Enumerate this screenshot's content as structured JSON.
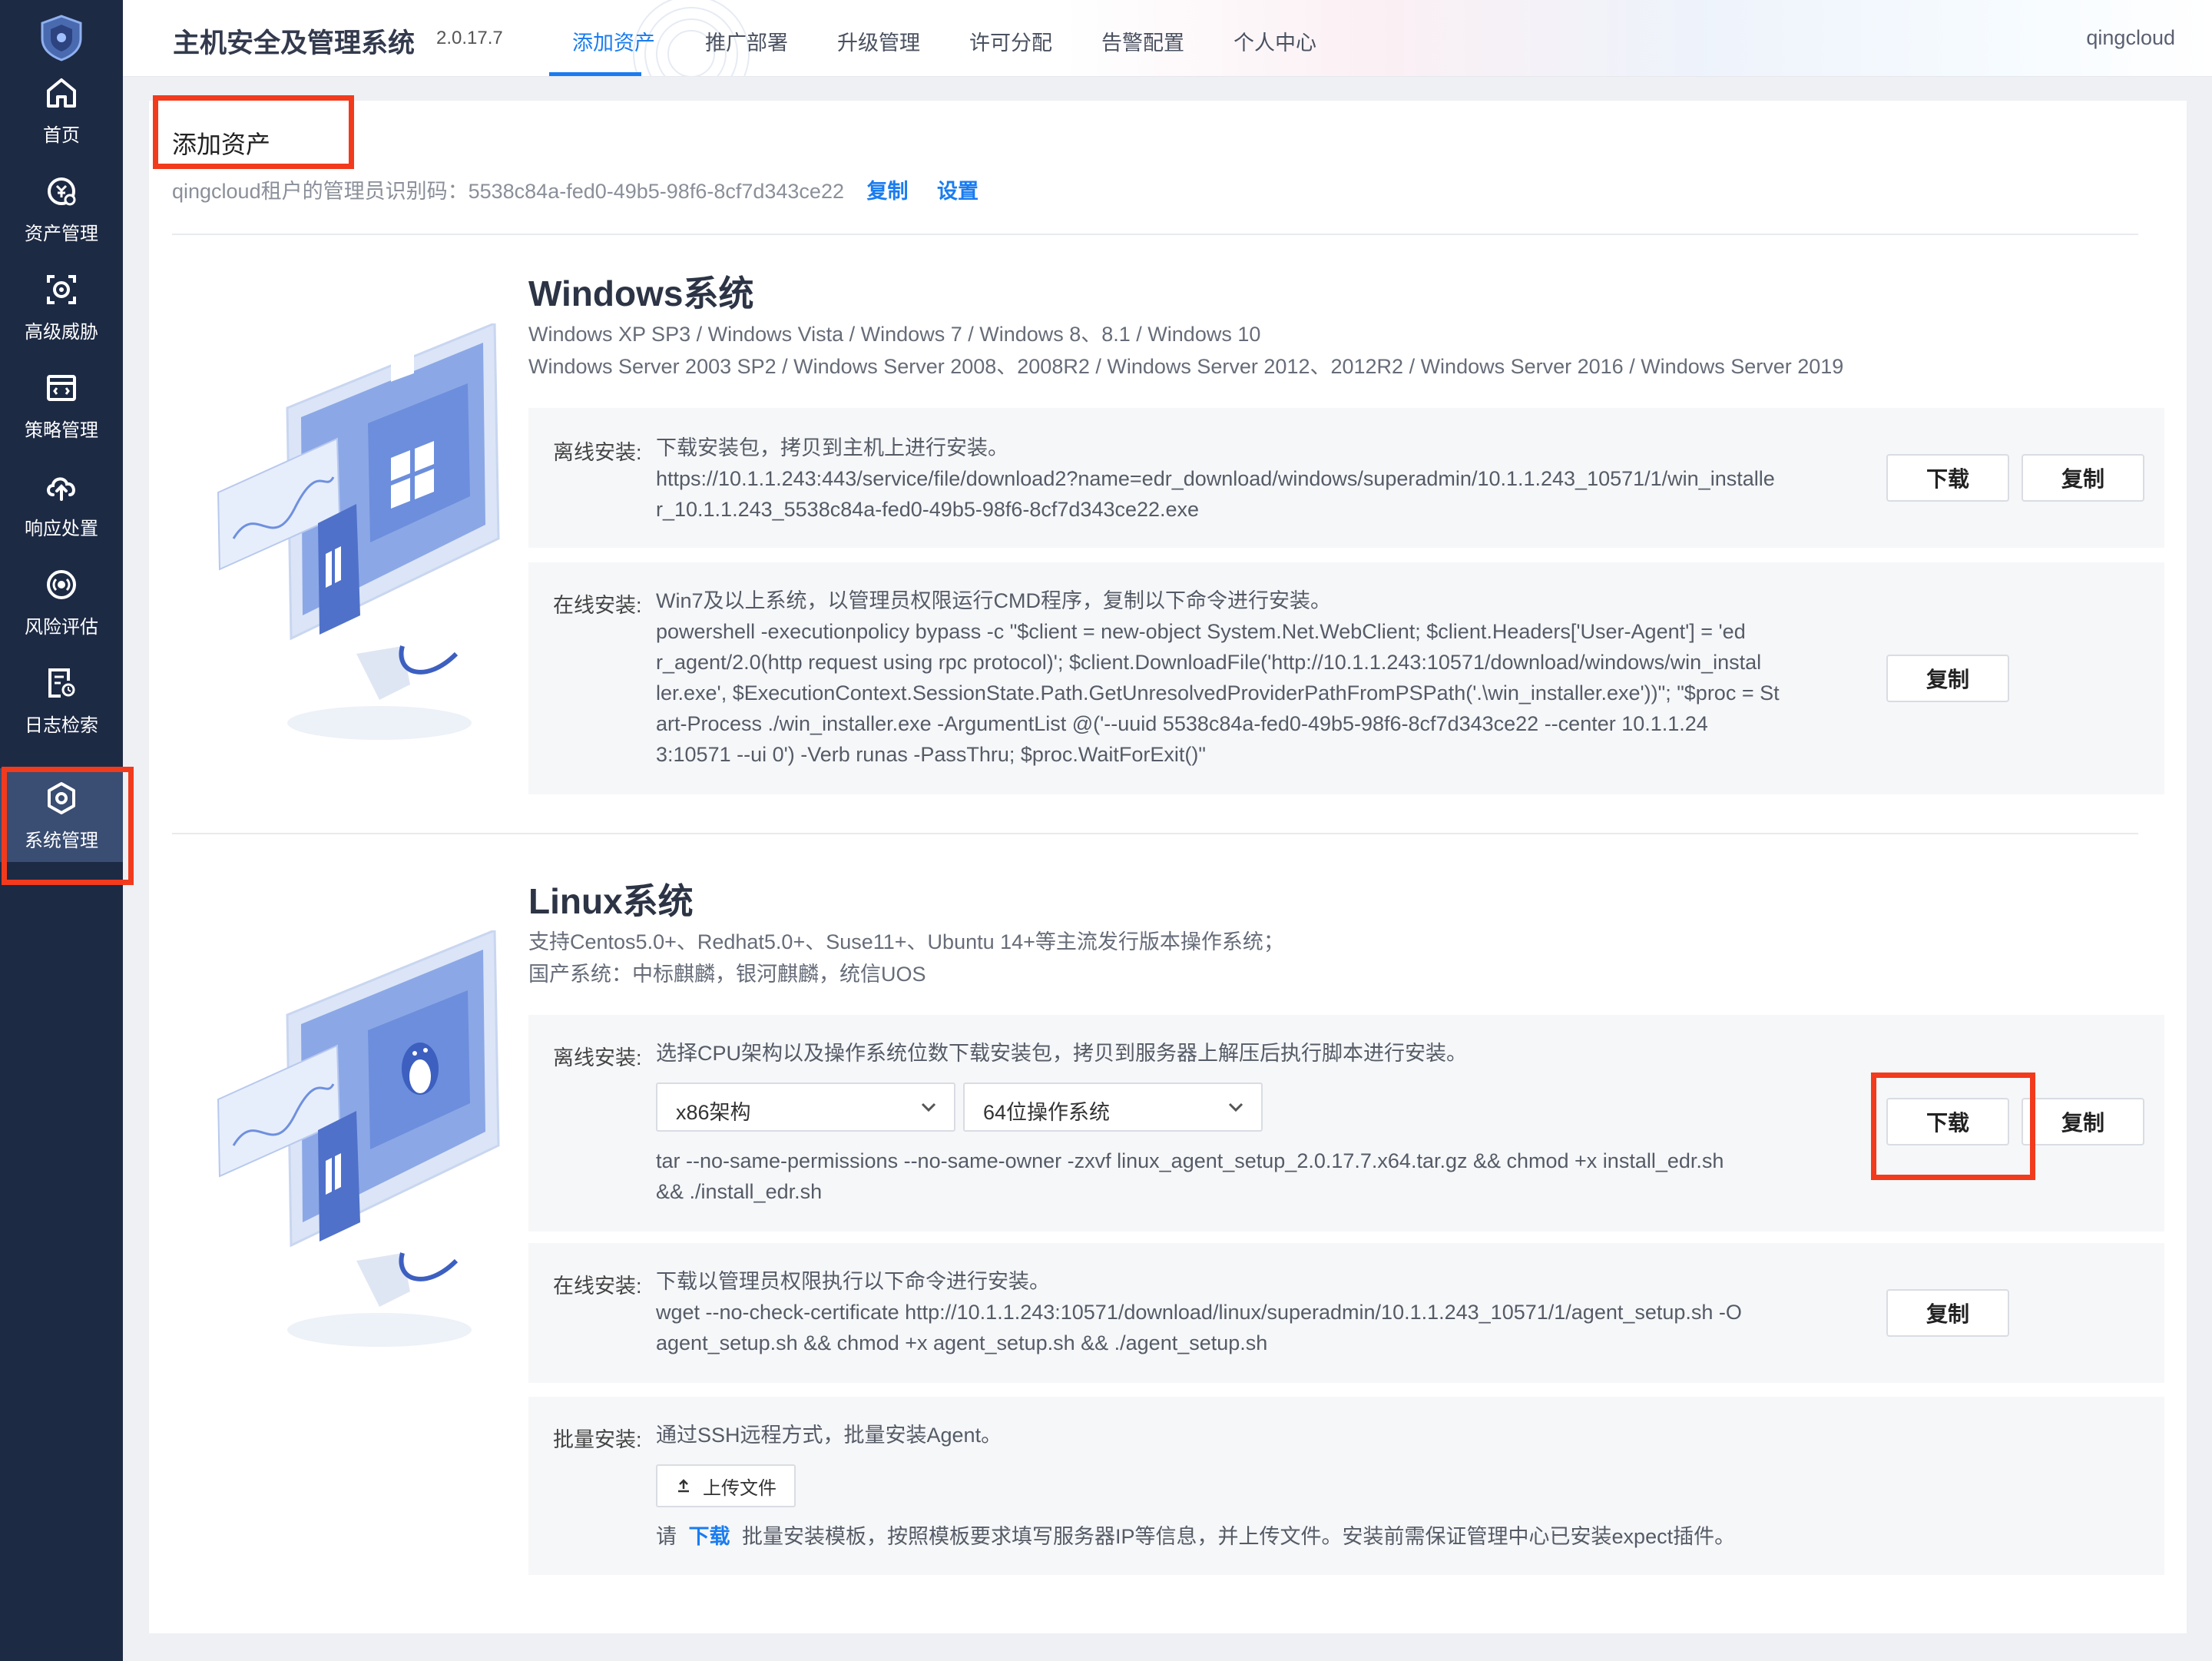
{
  "colors": {
    "sidebar_bg": "#1d2a44",
    "sidebar_active": "#3a4d72",
    "accent": "#1a7cf0",
    "highlight": "#f23a1d"
  },
  "sidebar": {
    "items": [
      {
        "label": "首页",
        "icon": "home-icon"
      },
      {
        "label": "资产管理",
        "icon": "asset-icon"
      },
      {
        "label": "高级威胁",
        "icon": "threat-icon"
      },
      {
        "label": "策略管理",
        "icon": "policy-icon"
      },
      {
        "label": "响应处置",
        "icon": "cloud-upload-icon"
      },
      {
        "label": "风险评估",
        "icon": "risk-icon"
      },
      {
        "label": "日志检索",
        "icon": "log-search-icon"
      },
      {
        "label": "系统管理",
        "icon": "system-settings-icon",
        "active": true
      }
    ]
  },
  "header": {
    "title": "主机安全及管理系统",
    "version": "2.0.17.7",
    "tabs": [
      {
        "label": "添加资产",
        "active": true
      },
      {
        "label": "推广部署"
      },
      {
        "label": "升级管理"
      },
      {
        "label": "许可分配"
      },
      {
        "label": "告警配置"
      },
      {
        "label": "个人中心"
      }
    ],
    "user": "qingcloud"
  },
  "main": {
    "page_title": "添加资产",
    "tenant_text": "qingcloud租户的管理员识别码：5538c84a-fed0-49b5-98f6-8cf7d343ce22",
    "copy_link": "复制",
    "settings_link": "设置",
    "windows": {
      "title": "Windows系统",
      "sub1": "Windows XP SP3 / Windows Vista / Windows 7 / Windows 8、8.1 / Windows 10",
      "sub2": "Windows Server 2003 SP2 / Windows Server 2008、2008R2 / Windows Server 2012、2012R2 / Windows Server 2016 / Windows Server 2019",
      "offline": {
        "label": "离线安装:",
        "desc": "下载安装包，拷贝到主机上进行安装。",
        "line1": "https://10.1.1.243:443/service/file/download2?name=edr_download/windows/superadmin/10.1.1.243_10571/1/win_installe",
        "line2": "r_10.1.1.243_5538c84a-fed0-49b5-98f6-8cf7d343ce22.exe",
        "download_btn": "下载",
        "copy_btn": "复制"
      },
      "online": {
        "label": "在线安装:",
        "desc": "Win7及以上系统，以管理员权限运行CMD程序，复制以下命令进行安装。",
        "line1": "powershell -executionpolicy bypass -c \"$client = new-object System.Net.WebClient; $client.Headers['User-Agent'] = 'ed",
        "line2": "r_agent/2.0(http request using rpc protocol)'; $client.DownloadFile('http://10.1.1.243:10571/download/windows/win_instal",
        "line3": "ler.exe', $ExecutionContext.SessionState.Path.GetUnresolvedProviderPathFromPSPath('.\\win_installer.exe'))\"; \"$proc = St",
        "line4": "art-Process ./win_installer.exe -ArgumentList @('--uuid 5538c84a-fed0-49b5-98f6-8cf7d343ce22 --center 10.1.1.24",
        "line5": "3:10571 --ui 0') -Verb runas -PassThru; $proc.WaitForExit()\"",
        "copy_btn": "复制"
      }
    },
    "linux": {
      "title": "Linux系统",
      "sub1": "支持Centos5.0+、Redhat5.0+、Suse11+、Ubuntu 14+等主流发行版本操作系统；",
      "sub2": "国产系统：中标麒麟，银河麒麟，统信UOS",
      "offline": {
        "label": "离线安装:",
        "desc": "选择CPU架构以及操作系统位数下载安装包，拷贝到服务器上解压后执行脚本进行安装。",
        "arch_select": "x86架构",
        "bits_select": "64位操作系统",
        "line1": "tar --no-same-permissions --no-same-owner -zxvf linux_agent_setup_2.0.17.7.x64.tar.gz && chmod +x install_edr.sh",
        "line2": "&& ./install_edr.sh",
        "download_btn": "下载",
        "copy_btn": "复制"
      },
      "online": {
        "label": "在线安装:",
        "desc": "下载以管理员权限执行以下命令进行安装。",
        "line1": "wget --no-check-certificate http://10.1.1.243:10571/download/linux/superadmin/10.1.1.243_10571/1/agent_setup.sh -O",
        "line2": "agent_setup.sh && chmod +x agent_setup.sh && ./agent_setup.sh",
        "copy_btn": "复制"
      },
      "batch": {
        "label": "批量安装:",
        "desc": "通过SSH远程方式，批量安装Agent。",
        "upload_btn": "上传文件",
        "note_prefix": "请",
        "note_link": "下载",
        "note_suffix": "批量安装模板，按照模板要求填写服务器IP等信息，并上传文件。安装前需保证管理中心已安装expect插件。"
      }
    }
  }
}
